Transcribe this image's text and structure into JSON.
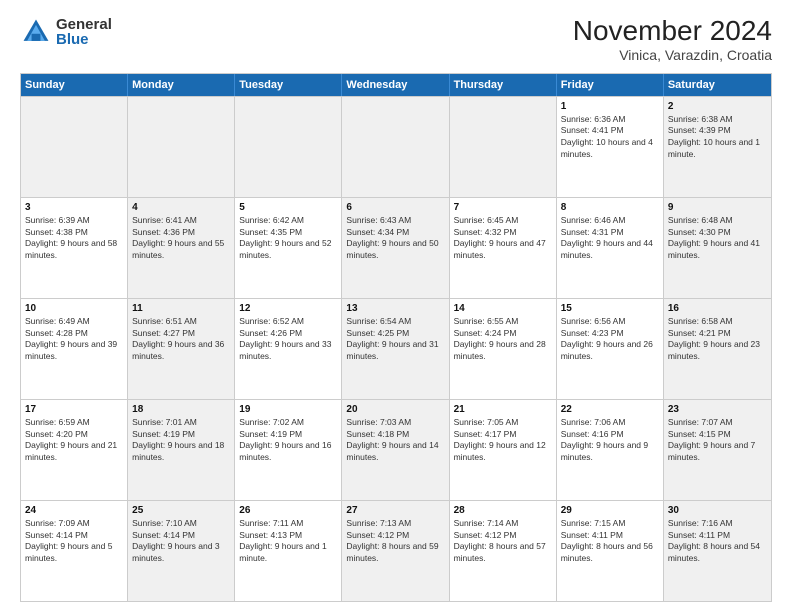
{
  "logo": {
    "general": "General",
    "blue": "Blue"
  },
  "title": "November 2024",
  "subtitle": "Vinica, Varazdin, Croatia",
  "header_days": [
    "Sunday",
    "Monday",
    "Tuesday",
    "Wednesday",
    "Thursday",
    "Friday",
    "Saturday"
  ],
  "rows": [
    [
      {
        "day": "",
        "info": "",
        "shaded": true
      },
      {
        "day": "",
        "info": "",
        "shaded": true
      },
      {
        "day": "",
        "info": "",
        "shaded": true
      },
      {
        "day": "",
        "info": "",
        "shaded": true
      },
      {
        "day": "",
        "info": "",
        "shaded": true
      },
      {
        "day": "1",
        "info": "Sunrise: 6:36 AM\nSunset: 4:41 PM\nDaylight: 10 hours and 4 minutes.",
        "shaded": false
      },
      {
        "day": "2",
        "info": "Sunrise: 6:38 AM\nSunset: 4:39 PM\nDaylight: 10 hours and 1 minute.",
        "shaded": true
      }
    ],
    [
      {
        "day": "3",
        "info": "Sunrise: 6:39 AM\nSunset: 4:38 PM\nDaylight: 9 hours and 58 minutes.",
        "shaded": false
      },
      {
        "day": "4",
        "info": "Sunrise: 6:41 AM\nSunset: 4:36 PM\nDaylight: 9 hours and 55 minutes.",
        "shaded": true
      },
      {
        "day": "5",
        "info": "Sunrise: 6:42 AM\nSunset: 4:35 PM\nDaylight: 9 hours and 52 minutes.",
        "shaded": false
      },
      {
        "day": "6",
        "info": "Sunrise: 6:43 AM\nSunset: 4:34 PM\nDaylight: 9 hours and 50 minutes.",
        "shaded": true
      },
      {
        "day": "7",
        "info": "Sunrise: 6:45 AM\nSunset: 4:32 PM\nDaylight: 9 hours and 47 minutes.",
        "shaded": false
      },
      {
        "day": "8",
        "info": "Sunrise: 6:46 AM\nSunset: 4:31 PM\nDaylight: 9 hours and 44 minutes.",
        "shaded": false
      },
      {
        "day": "9",
        "info": "Sunrise: 6:48 AM\nSunset: 4:30 PM\nDaylight: 9 hours and 41 minutes.",
        "shaded": true
      }
    ],
    [
      {
        "day": "10",
        "info": "Sunrise: 6:49 AM\nSunset: 4:28 PM\nDaylight: 9 hours and 39 minutes.",
        "shaded": false
      },
      {
        "day": "11",
        "info": "Sunrise: 6:51 AM\nSunset: 4:27 PM\nDaylight: 9 hours and 36 minutes.",
        "shaded": true
      },
      {
        "day": "12",
        "info": "Sunrise: 6:52 AM\nSunset: 4:26 PM\nDaylight: 9 hours and 33 minutes.",
        "shaded": false
      },
      {
        "day": "13",
        "info": "Sunrise: 6:54 AM\nSunset: 4:25 PM\nDaylight: 9 hours and 31 minutes.",
        "shaded": true
      },
      {
        "day": "14",
        "info": "Sunrise: 6:55 AM\nSunset: 4:24 PM\nDaylight: 9 hours and 28 minutes.",
        "shaded": false
      },
      {
        "day": "15",
        "info": "Sunrise: 6:56 AM\nSunset: 4:23 PM\nDaylight: 9 hours and 26 minutes.",
        "shaded": false
      },
      {
        "day": "16",
        "info": "Sunrise: 6:58 AM\nSunset: 4:21 PM\nDaylight: 9 hours and 23 minutes.",
        "shaded": true
      }
    ],
    [
      {
        "day": "17",
        "info": "Sunrise: 6:59 AM\nSunset: 4:20 PM\nDaylight: 9 hours and 21 minutes.",
        "shaded": false
      },
      {
        "day": "18",
        "info": "Sunrise: 7:01 AM\nSunset: 4:19 PM\nDaylight: 9 hours and 18 minutes.",
        "shaded": true
      },
      {
        "day": "19",
        "info": "Sunrise: 7:02 AM\nSunset: 4:19 PM\nDaylight: 9 hours and 16 minutes.",
        "shaded": false
      },
      {
        "day": "20",
        "info": "Sunrise: 7:03 AM\nSunset: 4:18 PM\nDaylight: 9 hours and 14 minutes.",
        "shaded": true
      },
      {
        "day": "21",
        "info": "Sunrise: 7:05 AM\nSunset: 4:17 PM\nDaylight: 9 hours and 12 minutes.",
        "shaded": false
      },
      {
        "day": "22",
        "info": "Sunrise: 7:06 AM\nSunset: 4:16 PM\nDaylight: 9 hours and 9 minutes.",
        "shaded": false
      },
      {
        "day": "23",
        "info": "Sunrise: 7:07 AM\nSunset: 4:15 PM\nDaylight: 9 hours and 7 minutes.",
        "shaded": true
      }
    ],
    [
      {
        "day": "24",
        "info": "Sunrise: 7:09 AM\nSunset: 4:14 PM\nDaylight: 9 hours and 5 minutes.",
        "shaded": false
      },
      {
        "day": "25",
        "info": "Sunrise: 7:10 AM\nSunset: 4:14 PM\nDaylight: 9 hours and 3 minutes.",
        "shaded": true
      },
      {
        "day": "26",
        "info": "Sunrise: 7:11 AM\nSunset: 4:13 PM\nDaylight: 9 hours and 1 minute.",
        "shaded": false
      },
      {
        "day": "27",
        "info": "Sunrise: 7:13 AM\nSunset: 4:12 PM\nDaylight: 8 hours and 59 minutes.",
        "shaded": true
      },
      {
        "day": "28",
        "info": "Sunrise: 7:14 AM\nSunset: 4:12 PM\nDaylight: 8 hours and 57 minutes.",
        "shaded": false
      },
      {
        "day": "29",
        "info": "Sunrise: 7:15 AM\nSunset: 4:11 PM\nDaylight: 8 hours and 56 minutes.",
        "shaded": false
      },
      {
        "day": "30",
        "info": "Sunrise: 7:16 AM\nSunset: 4:11 PM\nDaylight: 8 hours and 54 minutes.",
        "shaded": true
      }
    ]
  ]
}
